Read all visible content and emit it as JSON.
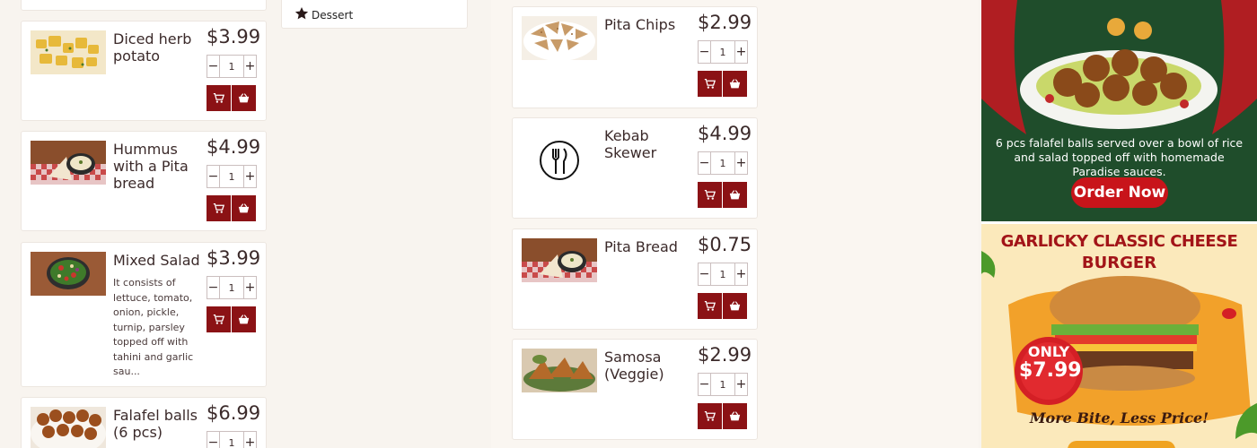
{
  "left_column": {
    "items": [
      {
        "name": "Diced herb potato",
        "price": "$3.99",
        "qty": "1",
        "description": ""
      },
      {
        "name": "Hummus with a Pita bread",
        "price": "$4.99",
        "qty": "1",
        "description": ""
      },
      {
        "name": "Mixed Salad",
        "price": "$3.99",
        "qty": "1",
        "description": "It consists of lettuce, tomato, onion, pickle, turnip, parsley topped off with tahini and garlic sau..."
      },
      {
        "name": "Falafel balls (6 pcs)",
        "price": "$6.99",
        "qty": "1",
        "description": ""
      }
    ]
  },
  "categories": {
    "dessert_label": "Dessert"
  },
  "right_column": {
    "items": [
      {
        "name": "Pita Chips",
        "price": "$2.99",
        "qty": "1"
      },
      {
        "name": "Kebab Skewer",
        "price": "$4.99",
        "qty": "1"
      },
      {
        "name": "Pita Bread",
        "price": "$0.75",
        "qty": "1"
      },
      {
        "name": "Samosa (Veggie)",
        "price": "$2.99",
        "qty": "1"
      }
    ]
  },
  "ads": {
    "falafel": {
      "text": "6 pcs falafel balls served over a bowl of rice and salad topped off with homemade Paradise sauces.",
      "cta": "Order Now"
    },
    "burger": {
      "title_line1": "GARLICKY CLASSIC CHEESE",
      "title_line2": "BURGER",
      "badge_top": "ONLY",
      "badge_price": "$7.99",
      "tagline": "More Bite, Less Price!"
    }
  },
  "colors": {
    "accent": "#8b1215",
    "background": "#f8f4ef"
  }
}
